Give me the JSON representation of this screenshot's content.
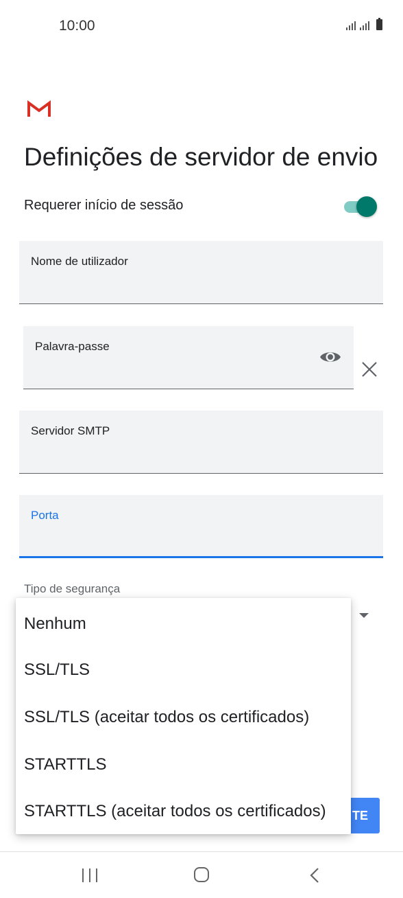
{
  "status_bar": {
    "time": "10:00",
    "icons": [
      "signal-icon",
      "signal-icon",
      "battery-icon"
    ]
  },
  "app": {
    "logo": "gmail-logo",
    "title": "Definições de servidor de envio"
  },
  "require_signin": {
    "label": "Requerer início de sessão",
    "enabled": true,
    "accent_color": "#00796b"
  },
  "fields": {
    "username": {
      "label": "Nome de utilizador",
      "value": ""
    },
    "password": {
      "label": "Palavra-passe",
      "value": "",
      "visibility_icon": "eye-icon",
      "clear_icon": "close-icon"
    },
    "smtp_server": {
      "label": "Servidor SMTP",
      "value": ""
    },
    "port": {
      "label": "Porta",
      "value": "",
      "focused": true,
      "focus_color": "#1a73e8"
    }
  },
  "security": {
    "label": "Tipo de segurança",
    "options": [
      "Nenhum",
      "SSL/TLS",
      "SSL/TLS (aceitar todos os certificados)",
      "STARTTLS",
      "STARTTLS (aceitar todos os certificados)"
    ]
  },
  "next_button": {
    "visible_text": "TE",
    "color": "#4285f4"
  },
  "nav_bar": {
    "icons": [
      "recent-apps-icon",
      "home-icon",
      "back-icon"
    ]
  }
}
